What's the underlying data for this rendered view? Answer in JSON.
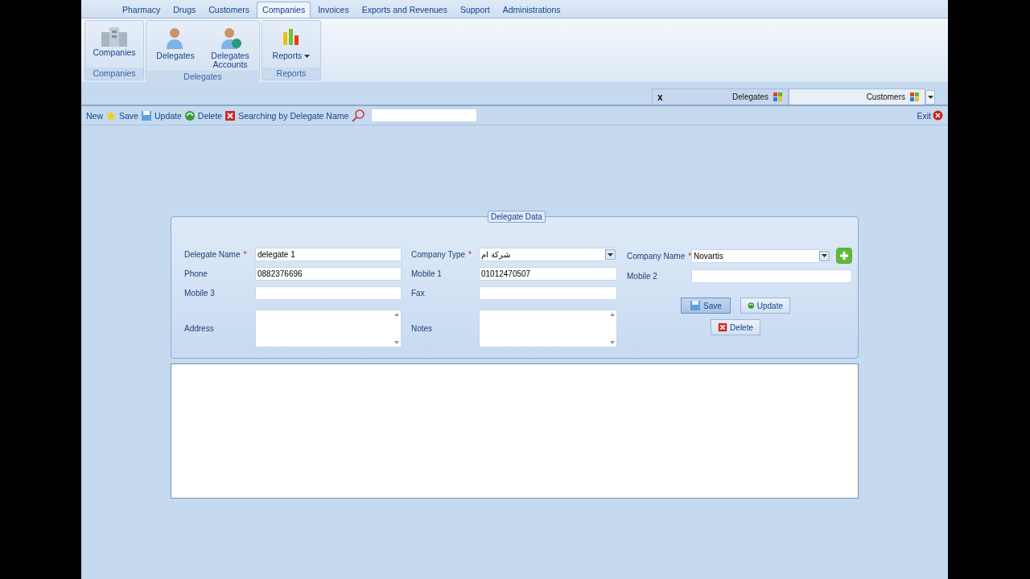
{
  "menu_tabs": [
    {
      "label": "Pharmacy",
      "selected": false
    },
    {
      "label": "Drugs",
      "selected": false
    },
    {
      "label": "Customers",
      "selected": false
    },
    {
      "label": "Companies",
      "selected": true
    },
    {
      "label": "Invoices",
      "selected": false
    },
    {
      "label": "Exports and Revenues",
      "selected": false
    },
    {
      "label": "Support",
      "selected": false
    },
    {
      "label": "Administrations",
      "selected": false
    }
  ],
  "ribbon_groups": [
    {
      "title": "Companies",
      "items": [
        {
          "label": "Companies"
        }
      ]
    },
    {
      "title": "Delegates",
      "items": [
        {
          "label": "Delegates"
        },
        {
          "label": "Delegates Accounts"
        }
      ]
    },
    {
      "title": "Reports",
      "items": [
        {
          "label": "Reports",
          "dropdown": true
        }
      ]
    }
  ],
  "doc_tabs": [
    {
      "label": "Delegates",
      "selected": true,
      "close": "x"
    },
    {
      "label": "Customers",
      "selected": false
    }
  ],
  "toolbar": {
    "items": [
      {
        "label": "New"
      },
      {
        "label": "Save"
      },
      {
        "label": "Update"
      },
      {
        "label": "Delete"
      },
      {
        "label": "Searching by Delegate Name"
      }
    ],
    "exit": "Exit"
  },
  "form": {
    "title": "Delegate Data",
    "columns": [
      {
        "fields": [
          {
            "label": "Delegate Name",
            "marker": "*",
            "kind": "text",
            "value": "delegate 1"
          },
          {
            "label": "Phone",
            "kind": "text",
            "value": "0882376696"
          },
          {
            "label": "Mobile 3",
            "kind": "text"
          },
          {
            "label": "Address",
            "kind": "memo"
          }
        ]
      },
      {
        "fields": [
          {
            "label": "Company Type",
            "marker": "*",
            "kind": "combo",
            "value": "شركة ام"
          },
          {
            "label": "Mobile 1",
            "kind": "text",
            "value": "01012470507"
          },
          {
            "label": "Fax",
            "kind": "text"
          },
          {
            "label": "Notes",
            "kind": "memo"
          }
        ]
      },
      {
        "fields": [
          {
            "label": "Company Name",
            "marker": "*",
            "kind": "combo",
            "value": "Novartis",
            "add": true
          },
          {
            "label": "Mobile 2",
            "kind": "text"
          }
        ]
      }
    ],
    "buttons": [
      {
        "label": "Save",
        "selected": true
      },
      {
        "label": "Update",
        "selected": false
      },
      {
        "label": "Delete",
        "selected": false
      }
    ]
  }
}
